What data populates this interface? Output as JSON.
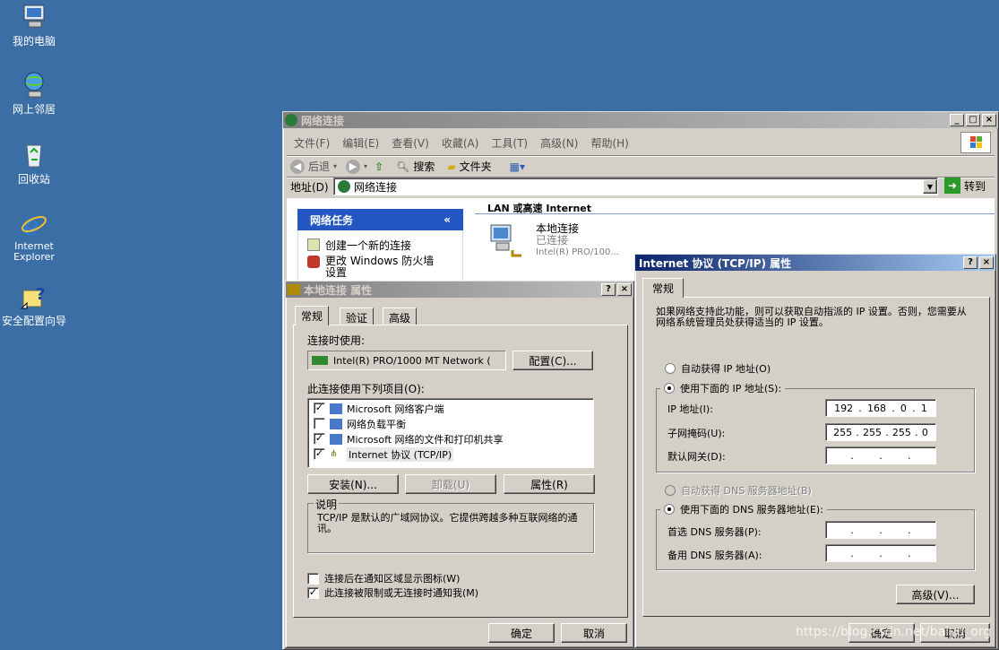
{
  "desktop": {
    "icons": [
      {
        "label": "我的电脑",
        "icon": "my-computer-icon"
      },
      {
        "label": "网上邻居",
        "icon": "network-places-icon"
      },
      {
        "label": "回收站",
        "icon": "recycle-bin-icon"
      },
      {
        "label": "Internet\nExplorer",
        "icon": "internet-explorer-icon"
      },
      {
        "label": "安全配置向导",
        "icon": "security-wizard-icon"
      }
    ]
  },
  "explorer": {
    "title": "网络连接",
    "menu": [
      "文件(F)",
      "编辑(E)",
      "查看(V)",
      "收藏(A)",
      "工具(T)",
      "高级(N)",
      "帮助(H)"
    ],
    "toolbar": {
      "back": "后退",
      "search": "搜索",
      "folders": "文件夹"
    },
    "address_label": "地址(D)",
    "address_value": "网络连接",
    "go_label": "转到",
    "task_panel": {
      "title": "网络任务",
      "items": [
        "创建一个新的连接",
        "更改 Windows 防火墙设置"
      ]
    },
    "section_header": "LAN 或高速 Internet",
    "connection": {
      "name": "本地连接",
      "status": "已连接",
      "device": "Intel(R) PRO/100..."
    }
  },
  "lan_props": {
    "title": "本地连接 属性",
    "tabs": [
      "常规",
      "验证",
      "高级"
    ],
    "connect_using_label": "连接时使用:",
    "adapter": "Intel(R) PRO/1000 MT Network (",
    "configure_label": "配置(C)...",
    "items_label": "此连接使用下列项目(O):",
    "items": [
      {
        "label": "Microsoft 网络客户端",
        "checked": true
      },
      {
        "label": "网络负载平衡",
        "checked": false
      },
      {
        "label": "Microsoft 网络的文件和打印机共享",
        "checked": true
      },
      {
        "label": "Internet 协议 (TCP/IP)",
        "checked": true
      }
    ],
    "install_label": "安装(N)...",
    "uninstall_label": "卸载(U)",
    "properties_label": "属性(R)",
    "desc_title": "说明",
    "desc_text": "TCP/IP 是默认的广域网协议。它提供跨越多种互联网络的通讯。",
    "show_icon_label": "连接后在通知区域显示图标(W)",
    "notify_label": "此连接被限制或无连接时通知我(M)",
    "show_icon_checked": false,
    "notify_checked": true,
    "ok_label": "确定",
    "cancel_label": "取消"
  },
  "tcpip": {
    "title": "Internet 协议 (TCP/IP) 属性",
    "tab": "常规",
    "intro": "如果网络支持此功能，则可以获取自动指派的 IP 设置。否则，您需要从网络系统管理员处获得适当的 IP 设置。",
    "auto_ip_label": "自动获得 IP 地址(O)",
    "manual_ip_label": "使用下面的 IP 地址(S):",
    "ip_label": "IP 地址(I):",
    "ip": [
      "192",
      "168",
      "0",
      "1"
    ],
    "mask_label": "子网掩码(U):",
    "mask": [
      "255",
      "255",
      "255",
      "0"
    ],
    "gateway_label": "默认网关(D):",
    "gateway": [
      "",
      "",
      "",
      ""
    ],
    "auto_dns_label": "自动获得 DNS 服务器地址(B)",
    "manual_dns_label": "使用下面的 DNS 服务器地址(E):",
    "pref_dns_label": "首选 DNS 服务器(P):",
    "alt_dns_label": "备用 DNS 服务器(A):",
    "advanced_label": "高级(V)...",
    "ok_label": "确定",
    "cancel_label": "取消"
  },
  "watermark": "https://blog.csdn.net/baiyu_org"
}
